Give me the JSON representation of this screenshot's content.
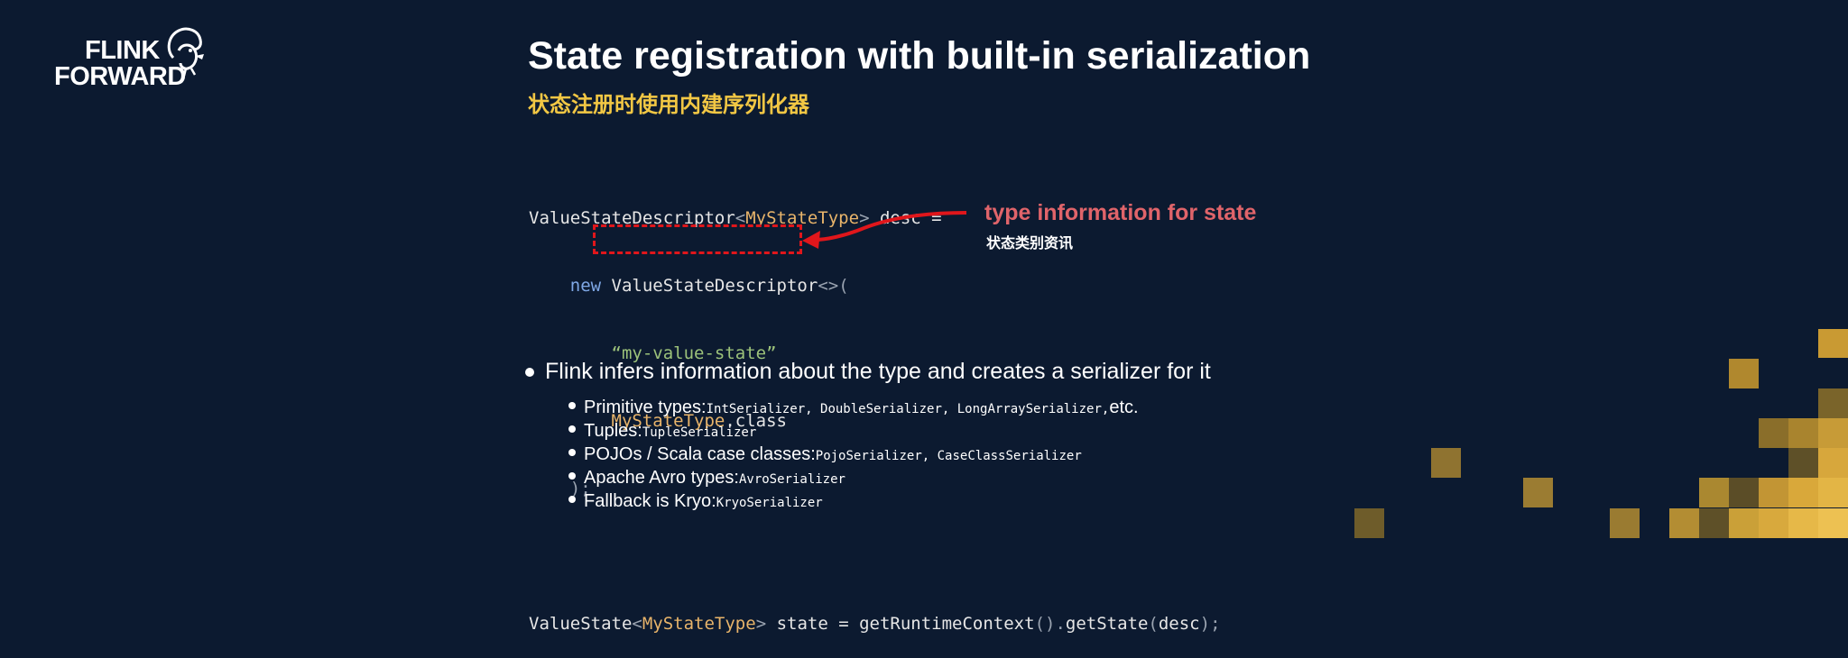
{
  "logo": {
    "line1": "FLINK",
    "line2": "FORWARD"
  },
  "slide": {
    "title": "State registration with built-in serialization",
    "subtitle": "状态注册时使用内建序列化器"
  },
  "code": {
    "line1": {
      "a": "ValueStateDescriptor",
      "b": "<",
      "c": "MyStateType",
      "d": ">",
      "e": " desc =",
      "f": ""
    },
    "line2": {
      "indent": "    ",
      "kw": "new",
      "a": " ValueStateDescriptor",
      "b": "<>(",
      "c": ""
    },
    "line3": {
      "indent": "        ",
      "str": "“my-value-state”"
    },
    "line4": {
      "indent": "        ",
      "ty": "MyStateType",
      "rest": ".class"
    },
    "line5": {
      "indent": "    ",
      "rest": ");"
    },
    "line7": {
      "a": "ValueState",
      "b": "<",
      "c": "MyStateType",
      "d": ">",
      "e": " state = getRuntimeContext",
      "f": "().",
      "g": "getState",
      "h": "(",
      "i": "desc",
      "j": ");"
    }
  },
  "annotation": {
    "title": "type information for state",
    "subtitle": "状态类别资讯"
  },
  "bullets": {
    "main": "Flink infers information about the type and creates a serializer for it",
    "items": [
      {
        "label": "Primitive types: ",
        "code": "IntSerializer, DoubleSerializer, LongArraySerializer,",
        "suffix": " etc."
      },
      {
        "label": "Tuples: ",
        "code": "TupleSerializer",
        "suffix": ""
      },
      {
        "label": "POJOs / Scala case classes: ",
        "code": "PojoSerializer, CaseClassSerializer",
        "suffix": ""
      },
      {
        "label": "Apache Avro types: ",
        "code": "AvroSerializer",
        "suffix": ""
      },
      {
        "label": "Fallback is Kryo: ",
        "code": "KryoSerializer",
        "suffix": ""
      }
    ]
  },
  "colors": {
    "background": "#0c1a30",
    "title": "#ffffff",
    "subtitle": "#f2c744",
    "annotation": "#e0646a",
    "highlight_box": "#e0161b",
    "pixel_gold": "#d9a63a"
  }
}
